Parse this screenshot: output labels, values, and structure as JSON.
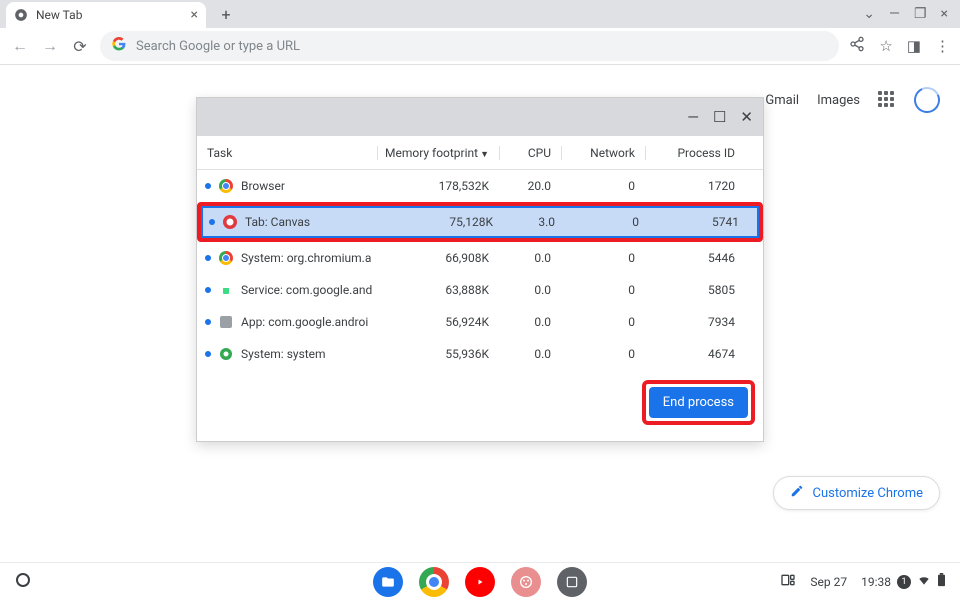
{
  "tab": {
    "title": "New Tab"
  },
  "omnibox": {
    "placeholder": "Search Google or type a URL"
  },
  "google_links": {
    "gmail": "Gmail",
    "images": "Images"
  },
  "task_manager": {
    "headers": {
      "task": "Task",
      "memory": "Memory footprint",
      "cpu": "CPU",
      "network": "Network",
      "pid": "Process ID"
    },
    "rows": [
      {
        "name": "Browser",
        "mem": "178,532K",
        "cpu": "20.0",
        "net": "0",
        "pid": "1720",
        "icon": "chrome-icon"
      },
      {
        "name": "Tab: Canvas",
        "mem": "75,128K",
        "cpu": "3.0",
        "net": "0",
        "pid": "5741",
        "icon": "canvas-icon"
      },
      {
        "name": "System: org.chromium.a",
        "mem": "66,908K",
        "cpu": "0.0",
        "net": "0",
        "pid": "5446",
        "icon": "chrome-icon"
      },
      {
        "name": "Service: com.google.and",
        "mem": "63,888K",
        "cpu": "0.0",
        "net": "0",
        "pid": "5805",
        "icon": "android-icon"
      },
      {
        "name": "App: com.google.androi",
        "mem": "56,924K",
        "cpu": "0.0",
        "net": "0",
        "pid": "7934",
        "icon": "app-icon"
      },
      {
        "name": "System: system",
        "mem": "55,936K",
        "cpu": "0.0",
        "net": "0",
        "pid": "4674",
        "icon": "system-icon"
      }
    ],
    "end_process": "End process"
  },
  "customize": {
    "label": "Customize Chrome"
  },
  "shelf": {
    "date": "Sep 27",
    "time": "19:38",
    "notif_count": "1"
  }
}
